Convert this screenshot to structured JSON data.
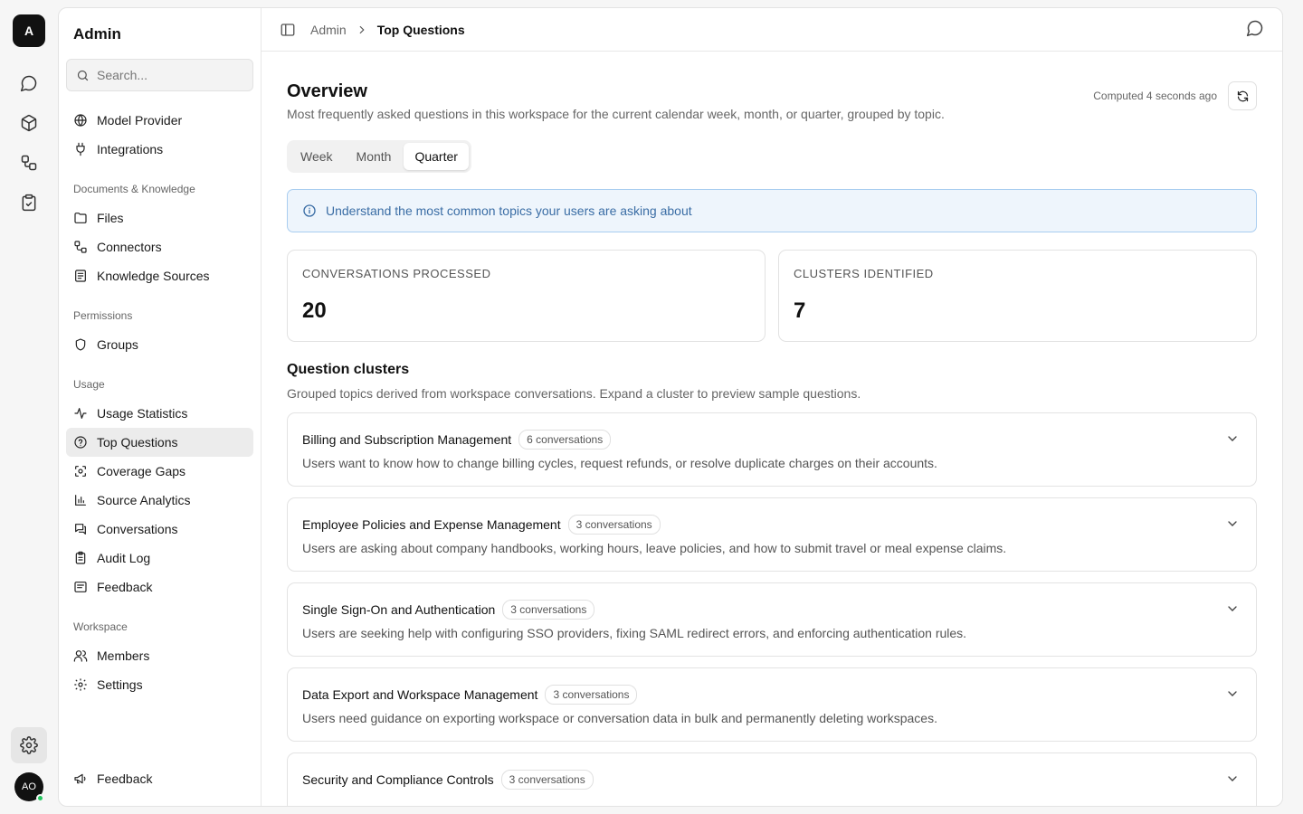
{
  "rail": {
    "workspace_initial": "A",
    "user_initials": "AO"
  },
  "sidebar": {
    "title": "Admin",
    "search_placeholder": "Search...",
    "top_items": [
      {
        "label": "Model Provider",
        "icon": "globe-icon"
      },
      {
        "label": "Integrations",
        "icon": "plug-icon"
      }
    ],
    "groups": [
      {
        "heading": "Documents & Knowledge",
        "items": [
          {
            "label": "Files",
            "icon": "folder-icon"
          },
          {
            "label": "Connectors",
            "icon": "connector-icon"
          },
          {
            "label": "Knowledge Sources",
            "icon": "document-icon"
          }
        ]
      },
      {
        "heading": "Permissions",
        "items": [
          {
            "label": "Groups",
            "icon": "shield-icon"
          }
        ]
      },
      {
        "heading": "Usage",
        "items": [
          {
            "label": "Usage Statistics",
            "icon": "activity-icon"
          },
          {
            "label": "Top Questions",
            "icon": "question-icon",
            "active": true
          },
          {
            "label": "Coverage Gaps",
            "icon": "scan-icon"
          },
          {
            "label": "Source Analytics",
            "icon": "bar-chart-icon"
          },
          {
            "label": "Conversations",
            "icon": "chat-icon"
          },
          {
            "label": "Audit Log",
            "icon": "clipboard-icon"
          },
          {
            "label": "Feedback",
            "icon": "message-square-icon"
          }
        ]
      },
      {
        "heading": "Workspace",
        "items": [
          {
            "label": "Members",
            "icon": "users-icon"
          },
          {
            "label": "Settings",
            "icon": "gear-icon"
          }
        ]
      }
    ],
    "footer_label": "Feedback"
  },
  "breadcrumb": {
    "parent": "Admin",
    "current": "Top Questions"
  },
  "overview": {
    "title": "Overview",
    "computed": "Computed 4 seconds ago",
    "subtitle": "Most frequently asked questions in this workspace for the current calendar week, month, or quarter, grouped by topic.",
    "tabs": [
      "Week",
      "Month",
      "Quarter"
    ],
    "active_tab": "Quarter",
    "banner": "Understand the most common topics your users are asking about"
  },
  "stats": [
    {
      "label": "CONVERSATIONS PROCESSED",
      "value": "20"
    },
    {
      "label": "CLUSTERS IDENTIFIED",
      "value": "7"
    }
  ],
  "clusters_section": {
    "title": "Question clusters",
    "subtitle": "Grouped topics derived from workspace conversations. Expand a cluster to preview sample questions.",
    "items": [
      {
        "name": "Billing and Subscription Management",
        "count": "6 conversations",
        "desc": "Users want to know how to change billing cycles, request refunds, or resolve duplicate charges on their accounts."
      },
      {
        "name": "Employee Policies and Expense Management",
        "count": "3 conversations",
        "desc": "Users are asking about company handbooks, working hours, leave policies, and how to submit travel or meal expense claims."
      },
      {
        "name": "Single Sign-On and Authentication",
        "count": "3 conversations",
        "desc": "Users are seeking help with configuring SSO providers, fixing SAML redirect errors, and enforcing authentication rules."
      },
      {
        "name": "Data Export and Workspace Management",
        "count": "3 conversations",
        "desc": "Users need guidance on exporting workspace or conversation data in bulk and permanently deleting workspaces."
      },
      {
        "name": "Security and Compliance Controls",
        "count": "3 conversations",
        "desc": ""
      }
    ]
  }
}
